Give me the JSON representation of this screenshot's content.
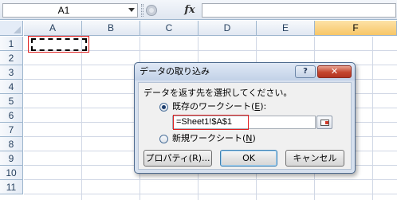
{
  "formula_bar": {
    "name_box": "A1",
    "fx_label": "fx",
    "formula": ""
  },
  "grid": {
    "columns": [
      "A",
      "B",
      "C",
      "D",
      "E",
      "F"
    ],
    "selected_column": "F",
    "rows": [
      "1",
      "2",
      "3",
      "4",
      "5",
      "6",
      "7",
      "8",
      "9",
      "10",
      "11"
    ]
  },
  "dialog": {
    "title": "データの取り込み",
    "help_label": "?",
    "close_label": "✕",
    "prompt": "データを返す先を選択してください。",
    "existing_sheet": {
      "text": "既存のワークシート(",
      "accel": "E",
      "suffix": "):",
      "checked": true
    },
    "reference": "=Sheet1!$A$1",
    "new_sheet": {
      "text": "新規ワークシート(",
      "accel": "N",
      "suffix": ")",
      "checked": false
    },
    "properties_button": "プロパティ(R)...",
    "ok_button": "OK",
    "cancel_button": "キャンセル"
  },
  "colors": {
    "accent_selection": "#f7c667",
    "highlight_border": "#e02020",
    "close_button": "#c4452d"
  }
}
